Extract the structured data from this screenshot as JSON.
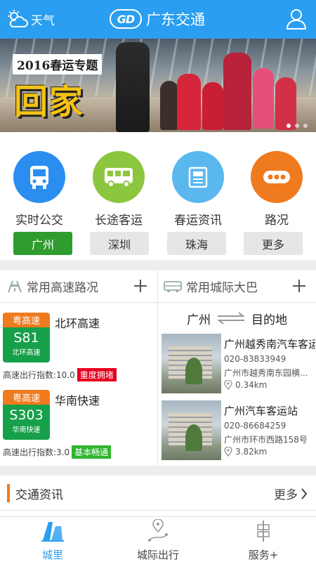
{
  "header": {
    "weather_label": "天气",
    "logo_text": "GD",
    "title": "广东交通",
    "icons": {
      "weather": "cloud-sun-icon",
      "user": "user-icon"
    }
  },
  "banner": {
    "tag": "2016春运专题",
    "headline": "回家",
    "dots_total": 3,
    "dots_active": 1
  },
  "quick_links": [
    {
      "label": "实时公交",
      "icon": "bus-stop-icon",
      "color": "#2a8ef0"
    },
    {
      "label": "长途客运",
      "icon": "coach-icon",
      "color": "#8cc63f"
    },
    {
      "label": "春运资讯",
      "icon": "news-icon",
      "color": "#5ab8ef"
    },
    {
      "label": "路况",
      "icon": "ellipsis-icon",
      "color": "#f07a1e"
    }
  ],
  "cities": [
    {
      "label": "广州",
      "active": true
    },
    {
      "label": "深圳",
      "active": false
    },
    {
      "label": "珠海",
      "active": false
    },
    {
      "label": "更多",
      "active": false
    }
  ],
  "highway": {
    "title": "常用高速路况",
    "items": [
      {
        "province": "粤高速",
        "code": "S81",
        "sub": "北环高速",
        "name": "北环高速",
        "index_label": "高速出行指数:10.0",
        "status": "重度拥堵",
        "status_color": "#e6001e"
      },
      {
        "province": "粤高速",
        "code": "S303",
        "sub": "华南快速",
        "name": "华南快速",
        "index_label": "高速出行指数:3.0",
        "status": "基本畅通",
        "status_color": "#2fb52f"
      }
    ]
  },
  "intercity": {
    "title": "常用城际大巴",
    "from": "广州",
    "to": "目的地",
    "stations": [
      {
        "name": "广州越秀南汽车客运...",
        "phone": "020-83833949",
        "address": "广州市越秀南东园横...",
        "distance": "0.34km"
      },
      {
        "name": "广州汽车客运站",
        "phone": "020-86684259",
        "address": "广州市环市西路158号",
        "distance": "3.82km"
      }
    ]
  },
  "news": {
    "title": "交通资讯",
    "more": "更多"
  },
  "tabbar": [
    {
      "label": "城里",
      "icon": "city-icon",
      "active": true
    },
    {
      "label": "城际出行",
      "icon": "route-pin-icon",
      "active": false
    },
    {
      "label": "服务+",
      "icon": "signpost-icon",
      "active": false
    }
  ],
  "colors": {
    "primary": "#2a9ef0",
    "accent_orange": "#f07a1e",
    "city_active": "#2f9c2f"
  }
}
